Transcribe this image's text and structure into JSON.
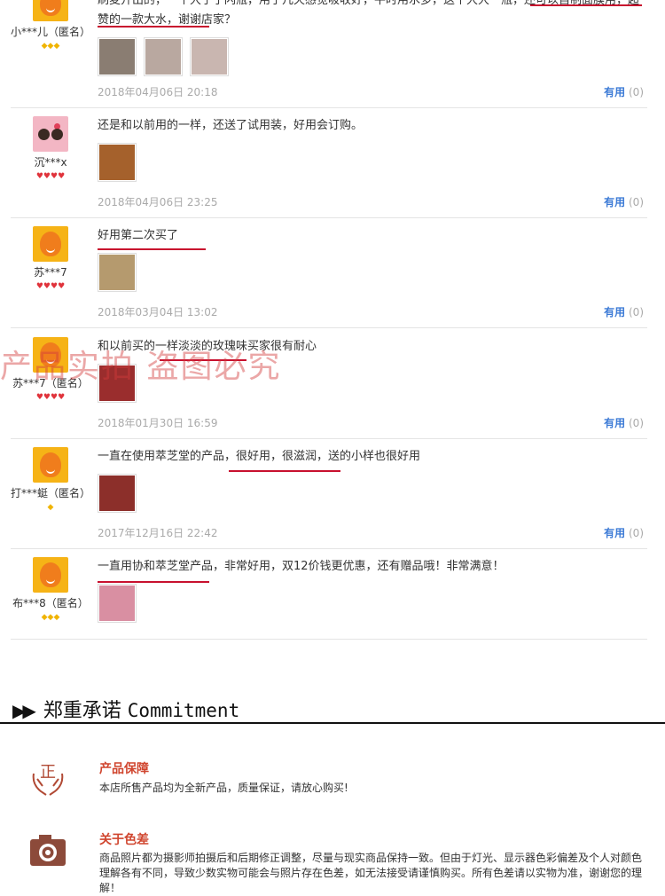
{
  "reviews": [
    {
      "user": "小***儿（匿名）",
      "level": "◆◆◆",
      "text": "刷麦开出的，一个大于了闪瓶，用了几天感觉吸收好，平时用水多，这个大大一瓶，还可以自制面膜用，超赞的一款大水，谢谢店家？",
      "date": "2018年04月06日 20:18",
      "useful": "有用",
      "useful_count": "(0)",
      "thumbs": [
        "#8a7d72",
        "#b9a8a0",
        "#c9b6b0"
      ]
    },
    {
      "user": "沉***x",
      "level": "♥♥♥♥",
      "text": "还是和以前用的一样，还送了试用装，好用会订购。",
      "date": "2018年04月06日 23:25",
      "useful": "有用",
      "useful_count": "(0)",
      "thumbs": [
        "#a5612c"
      ]
    },
    {
      "user": "苏***7",
      "level": "♥♥♥♥",
      "text": "好用第二次买了",
      "date": "2018年03月04日 13:02",
      "useful": "有用",
      "useful_count": "(0)",
      "thumbs": [
        "#b59a6e"
      ]
    },
    {
      "user": "苏***7（匿名）",
      "level": "♥♥♥♥",
      "text": "和以前买的一样淡淡的玫瑰味买家很有耐心",
      "date": "2018年01月30日 16:59",
      "useful": "有用",
      "useful_count": "(0)",
      "thumbs": [
        "#9a2d2d"
      ]
    },
    {
      "user": "打***蜓（匿名）",
      "level": "◆",
      "text": "一直在使用萃芝堂的产品，很好用，很滋润，送的小样也很好用",
      "date": "2017年12月16日 22:42",
      "useful": "有用",
      "useful_count": "(0)",
      "thumbs": [
        "#8c2f2a"
      ]
    },
    {
      "user": "布***8（匿名）",
      "level": "◆◆◆",
      "text": "一直用协和萃芝堂产品，非常好用，双12价钱更优惠，还有赠品哦！非常满意！",
      "date": "",
      "useful": "",
      "useful_count": "",
      "thumbs": [
        "#d98fa2"
      ]
    }
  ],
  "watermark": "产品实拍 盗图必究",
  "commitment": {
    "arrows": "▶▶",
    "title_cn": "郑重承诺",
    "title_en": "Commitment",
    "items": [
      {
        "icon": "hands-zheng-icon",
        "heading": "产品保障",
        "body": "本店所售产品均为全新产品，质量保证，请放心购买!"
      },
      {
        "icon": "camera-icon",
        "heading": "关于色差",
        "body": "商品照片都为摄影师拍摄后和后期修正调整，尽量与现实商品保持一致。但由于灯光、显示器色彩偏差及个人对颜色理解各有不同，导致少数实物可能会与照片存在色差，如无法接受请谨慎购买。所有色差请以实物为准，谢谢您的理解！"
      }
    ]
  },
  "colors": {
    "accent_red": "#c8102e",
    "link_blue": "#3d7bd6",
    "heading_red": "#d0452e"
  }
}
